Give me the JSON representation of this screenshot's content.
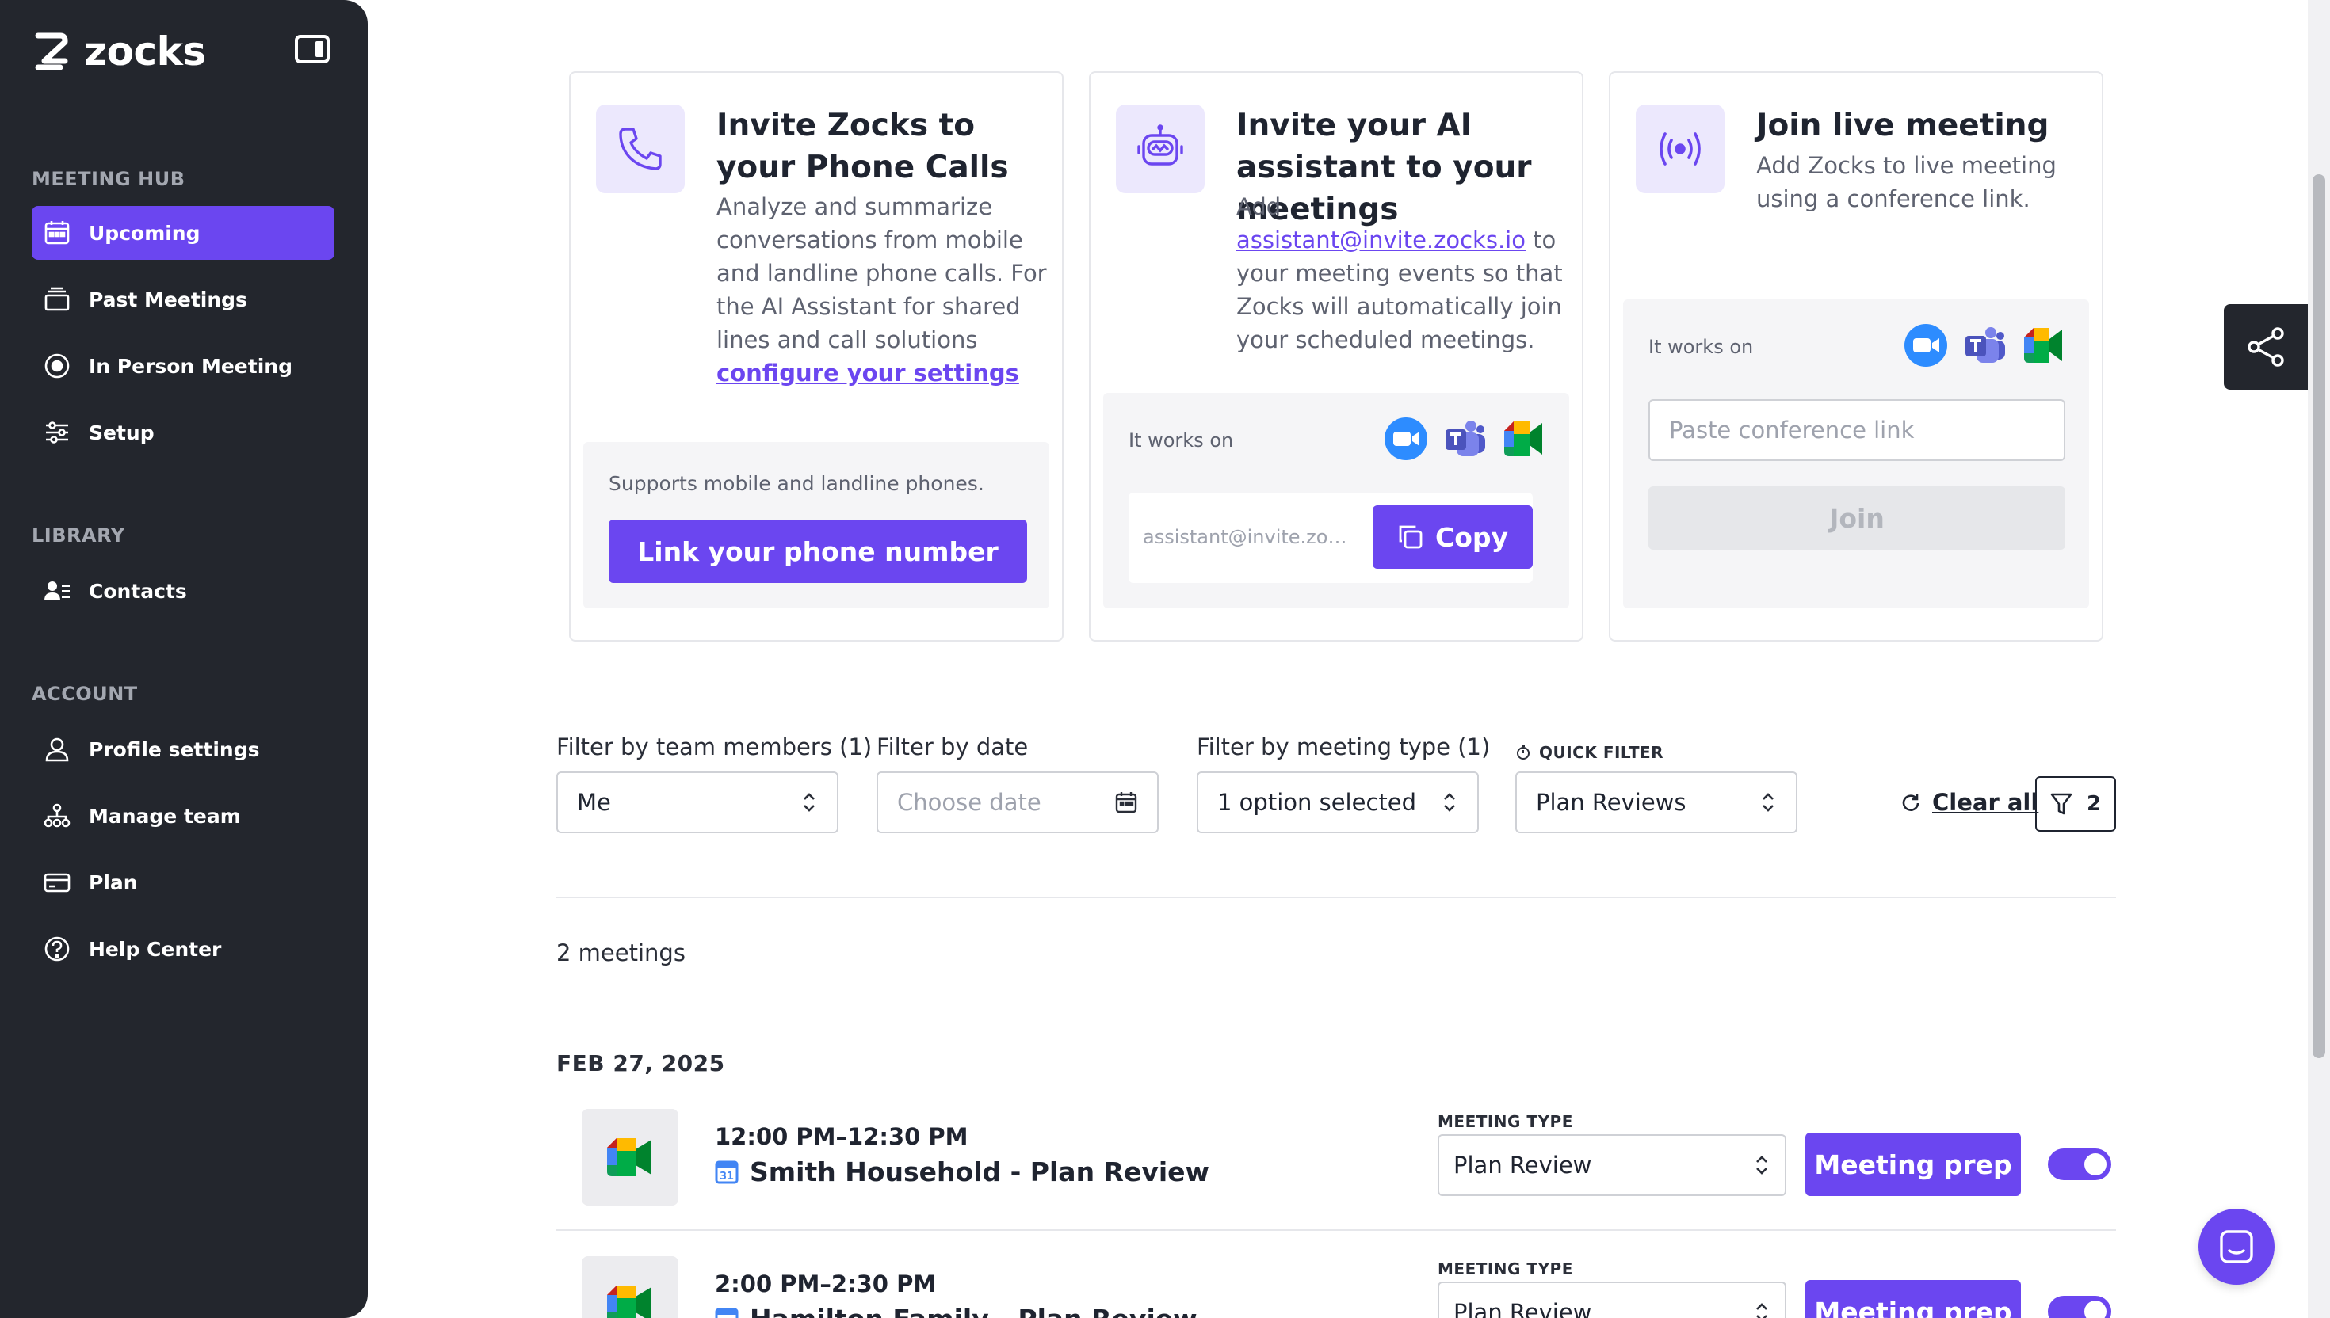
{
  "brand": {
    "name": "zocks",
    "accent": "#6b46f0",
    "sidebar_bg": "#23262d"
  },
  "sidebar": {
    "sections": [
      {
        "label": "MEETING HUB",
        "items": [
          {
            "label": "Upcoming",
            "icon": "calendar-icon",
            "active": true
          },
          {
            "label": "Past Meetings",
            "icon": "stack-icon"
          },
          {
            "label": "In Person Meeting",
            "icon": "record-icon"
          },
          {
            "label": "Setup",
            "icon": "sliders-icon"
          }
        ]
      },
      {
        "label": "LIBRARY",
        "items": [
          {
            "label": "Contacts",
            "icon": "contacts-icon"
          }
        ]
      },
      {
        "label": "ACCOUNT",
        "items": [
          {
            "label": "Profile settings",
            "icon": "user-icon"
          },
          {
            "label": "Manage team",
            "icon": "team-icon"
          },
          {
            "label": "Plan",
            "icon": "credit-card-icon"
          },
          {
            "label": "Help Center",
            "icon": "help-icon"
          }
        ]
      }
    ]
  },
  "cards": {
    "phone": {
      "title": "Invite Zocks to your Phone Calls",
      "desc": "Analyze and summarize conversations from mobile and landline phone calls.",
      "desc2": "For the AI Assistant for shared lines and call solutions",
      "link": "configure your settings",
      "note": "Supports mobile and landline phones.",
      "button": "Link your phone number"
    },
    "assistant": {
      "title": "Invite your AI assistant to your meetings",
      "desc_pre": "Add",
      "email": "assistant@invite.zocks.io",
      "desc_post": "to your meeting events so that Zocks will automatically join your scheduled meetings.",
      "works_on": "It works on",
      "email_truncated": "assistant@invite.zocks.io",
      "copy": "Copy"
    },
    "live": {
      "title": "Join live meeting",
      "desc": "Add Zocks to live meeting using a conference link.",
      "works_on": "It works on",
      "placeholder": "Paste conference link",
      "join": "Join"
    }
  },
  "filters": {
    "team": {
      "label": "Filter by team members (1)",
      "value": "Me"
    },
    "date": {
      "label": "Filter by date",
      "placeholder": "Choose date"
    },
    "type": {
      "label": "Filter by meeting type (1)",
      "value": "1 option selected"
    },
    "quick": {
      "label": "QUICK FILTER",
      "value": "Plan Reviews"
    },
    "clear_all": "Clear all",
    "count": "2"
  },
  "meetings": {
    "count_label": "2 meetings",
    "date_heading": "FEB 27, 2025",
    "type_label": "MEETING TYPE",
    "prep_label": "Meeting prep",
    "items": [
      {
        "time": "12:00 PM–12:30 PM",
        "title": "Smith Household - Plan Review",
        "type": "Plan Review",
        "enabled": true
      },
      {
        "time": "2:00 PM–2:30 PM",
        "title": "Hamilton Family - Plan Review",
        "type": "Plan Review",
        "enabled": true
      }
    ]
  }
}
